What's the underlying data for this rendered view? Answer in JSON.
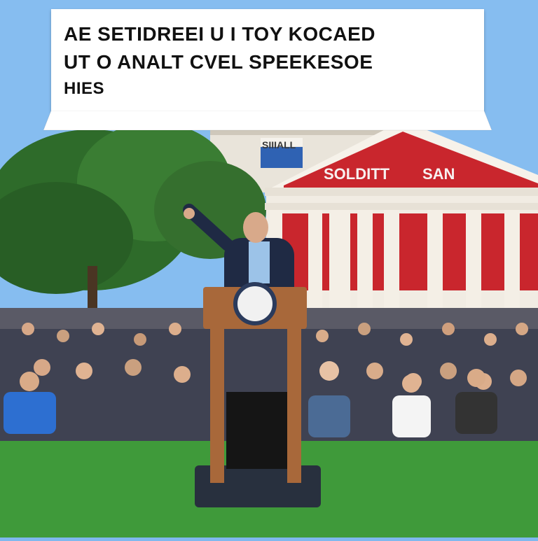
{
  "banner": {
    "line1": "AE SETIDREEI U I TOY KOCAED",
    "line2": "UT O ANALT CVEL SPEEKESOE",
    "line3": "HIES"
  },
  "building": {
    "sign_left": "SOLDITT",
    "sign_right": "SAN",
    "top_sign": "SIIIALL"
  },
  "colors": {
    "sky": "#7fb8ee",
    "grass": "#3f9a3a",
    "pediment_red": "#c9262d",
    "podium_wood": "#a8683a",
    "jacket": "#1f2a44"
  }
}
